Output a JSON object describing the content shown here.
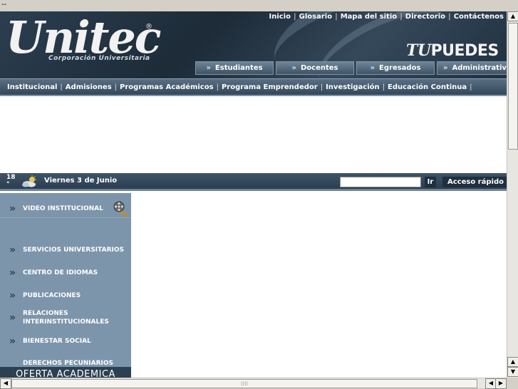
{
  "window": {
    "title": "--"
  },
  "header": {
    "logo_word": "Unitec",
    "logo_reg": "®",
    "logo_sub": "Corporación Universitaria",
    "tagline_tu": "TU",
    "tagline_rest": "PUEDES",
    "top_links": [
      "Inicio",
      "Glosario",
      "Mapa del sitio",
      "Directorio",
      "Contáctenos"
    ],
    "role_tabs": [
      "Estudiantes",
      "Docentes",
      "Egresados",
      "Administrativos"
    ],
    "tab_arrow": "»"
  },
  "main_menu": [
    "Institucional",
    "Admisiones",
    "Programas Académicos",
    "Programa Emprendedor",
    "Investigación",
    "Educación Continua"
  ],
  "datebar": {
    "temperature": "18",
    "temperature_unit": "°",
    "weather_icon": "partly-cloudy-icon",
    "date": "Viernes 3 de Junio",
    "search_value": "",
    "go_label": "Ir",
    "quick_access": "Acceso rápido"
  },
  "sidebar": {
    "items": [
      "VIDEO INSTITUCIONAL",
      "SERVICIOS UNIVERSITARIOS",
      "CENTRO DE IDIOMAS",
      "PUBLICACIONES",
      "RELACIONES INTERINSTITUCIONALES",
      "BIENESTAR SOCIAL",
      "DERECHOS PECUNIARIOS"
    ],
    "chevron": "»",
    "oferta": "OFERTA ACADEMICA"
  },
  "scrollbars": {
    "up": "▲",
    "down": "▼",
    "left": "◀",
    "right": "▶",
    "grip": "⁞⁞⁞⁞"
  },
  "colors": {
    "header_dark": "#1d2b38",
    "menu_blue": "#5a6f83",
    "sidebar": "#7c95ab"
  }
}
